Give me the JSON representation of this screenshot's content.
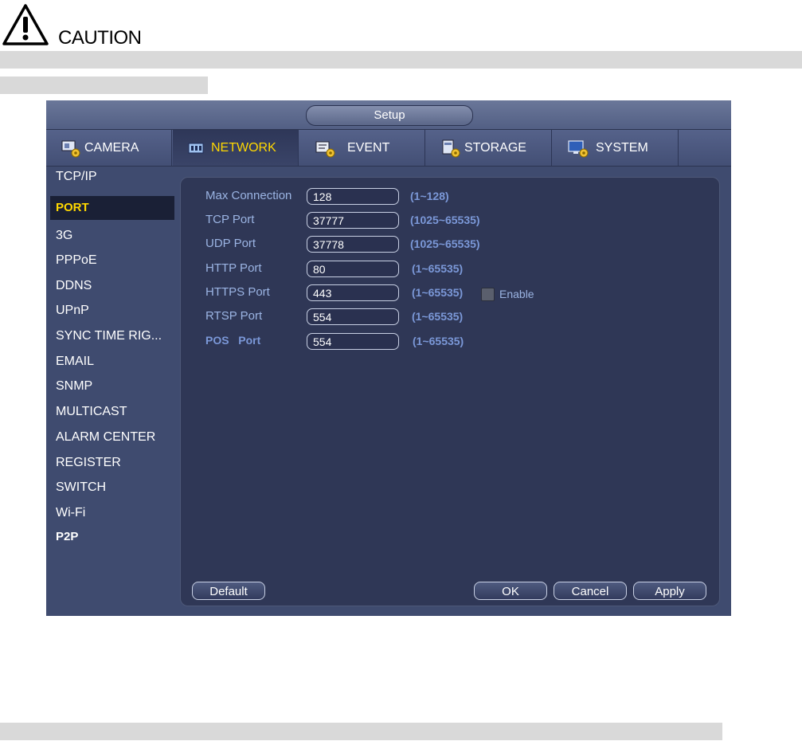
{
  "doc": {
    "caution_label": "CAUTION"
  },
  "window": {
    "title": "Setup",
    "tabs": [
      {
        "label": "CAMERA",
        "icon": "camera-gear-icon"
      },
      {
        "label": "NETWORK",
        "icon": "network-icon"
      },
      {
        "label": "EVENT",
        "icon": "event-gear-icon"
      },
      {
        "label": "STORAGE",
        "icon": "storage-gear-icon"
      },
      {
        "label": "SYSTEM",
        "icon": "system-gear-icon"
      }
    ],
    "active_tab": "NETWORK",
    "sidebar": [
      "TCP/IP",
      "PORT",
      "3G",
      "PPPoE",
      "DDNS",
      "UPnP",
      "SYNC TIME RIG...",
      "EMAIL",
      "SNMP",
      "MULTICAST",
      "ALARM CENTER",
      "REGISTER",
      "SWITCH",
      "Wi-Fi",
      "P2P"
    ],
    "active_sidebar": "PORT",
    "fields": [
      {
        "label": "Max Connection",
        "value": "128",
        "range": "(1~128)"
      },
      {
        "label": "TCP Port",
        "value": "37777",
        "range": "(1025~65535)"
      },
      {
        "label": "UDP Port",
        "value": "37778",
        "range": "(1025~65535)"
      },
      {
        "label": "HTTP Port",
        "value": "80",
        "range": "(1~65535)"
      },
      {
        "label": "HTTPS Port",
        "value": "443",
        "range": "(1~65535)"
      },
      {
        "label": "RTSP Port",
        "value": "554",
        "range": "(1~65535)"
      },
      {
        "label": "POS   Port",
        "value": "554",
        "range": "(1~65535)"
      }
    ],
    "https_enable": {
      "label": "Enable",
      "checked": false
    },
    "buttons": {
      "default": "Default",
      "ok": "OK",
      "cancel": "Cancel",
      "apply": "Apply"
    }
  }
}
